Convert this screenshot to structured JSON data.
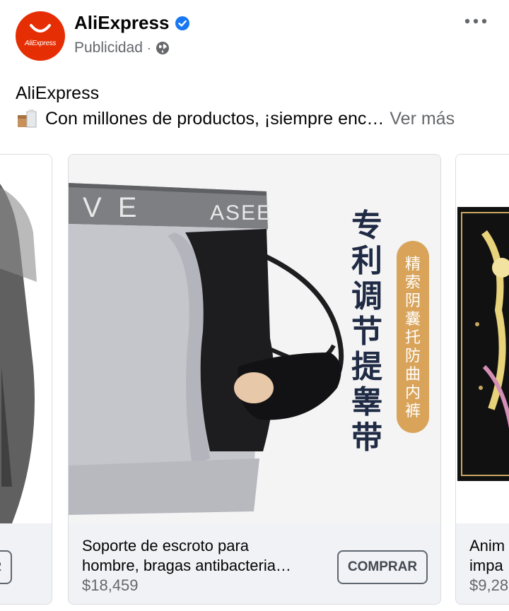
{
  "post": {
    "page_name": "AliExpress",
    "avatar_logo_text": "AliExpress",
    "sponsored_label": "Publicidad",
    "separator": "·",
    "body_title": "AliExpress",
    "body_text": "Con millones de productos, ¡siempre enc…",
    "see_more": "Ver más",
    "icons": [
      "verified-badge-icon",
      "globe-icon",
      "more-options-icon",
      "package-emoji-icon"
    ]
  },
  "carousel": {
    "cards": [
      {
        "cta": "COMPRAR"
      },
      {
        "title_line1": "Soporte de escroto para",
        "title_line2": "hombre, bragas antibacteria…",
        "price": "$18,459",
        "cta": "COMPRAR",
        "image_text_vertical": "专利调节提睾带",
        "image_badge_vertical": "精索阴囊托防曲内裤",
        "waistband_text": "VE     ASEE"
      },
      {
        "title_line1": "Anim",
        "title_line2": "impa",
        "price": "$9,28"
      }
    ]
  },
  "colors": {
    "brand_red": "#e62e04",
    "verified_blue": "#1877f2",
    "secondary_text": "#65676b",
    "footer_bg": "#f0f2f5"
  }
}
